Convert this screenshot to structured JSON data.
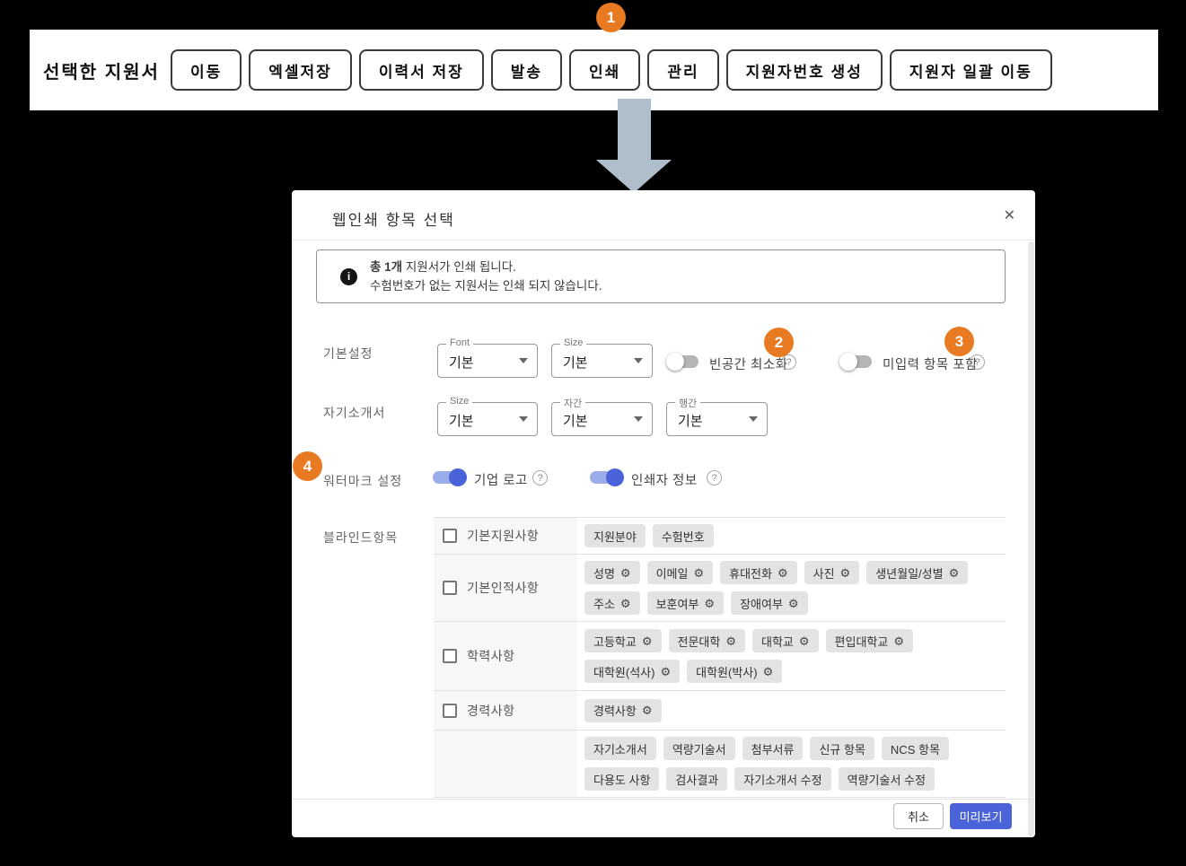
{
  "colors": {
    "accent_orange": "#E87A22",
    "primary_blue": "#4A63D9",
    "arrow_gray": "#B0BDCB",
    "chip_gray": "#E3E3E3"
  },
  "toolbar": {
    "label": "선택한 지원서",
    "buttons": [
      "이동",
      "엑셀저장",
      "이력서 저장",
      "발송",
      "인쇄",
      "관리",
      "지원자번호 생성",
      "지원자 일괄 이동"
    ]
  },
  "callouts": {
    "c1": "1",
    "c2": "2",
    "c3": "3",
    "c4": "4"
  },
  "modal": {
    "title": "웹인쇄 항목 선택",
    "close_icon": "✕",
    "notice": {
      "emphasis": "총 1개",
      "line1_rest": " 지원서가 인쇄 됩니다.",
      "line2": "수험번호가 없는 지원서는 인쇄 되지 않습니다."
    },
    "basic": {
      "label": "기본설정",
      "selects": [
        {
          "legend": "Font",
          "value": "기본"
        },
        {
          "legend": "Size",
          "value": "기본"
        }
      ],
      "toggle": {
        "label": "빈공간 최소화",
        "state": "off"
      }
    },
    "unfilled_toggle": {
      "label": "미입력 항목 포함",
      "state": "off"
    },
    "cover": {
      "label": "자기소개서",
      "selects": [
        {
          "legend": "Size",
          "value": "기본"
        },
        {
          "legend": "자간",
          "value": "기본"
        },
        {
          "legend": "행간",
          "value": "기본"
        }
      ]
    },
    "watermark": {
      "label": "워터마크 설정",
      "toggles": [
        {
          "label": "기업 로고",
          "state": "on"
        },
        {
          "label": "인쇄자 정보",
          "state": "on"
        }
      ]
    },
    "blind": {
      "label": "블라인드항목",
      "gear_icon": "⚙",
      "rows": [
        {
          "group": "기본지원사항",
          "checkbox": true,
          "lines": [
            [
              {
                "label": "지원분야",
                "gear": false
              },
              {
                "label": "수험번호",
                "gear": false
              }
            ]
          ]
        },
        {
          "group": "기본인적사항",
          "checkbox": true,
          "lines": [
            [
              {
                "label": "성명",
                "gear": true
              },
              {
                "label": "이메일",
                "gear": true
              },
              {
                "label": "휴대전화",
                "gear": true
              },
              {
                "label": "사진",
                "gear": true
              },
              {
                "label": "생년월일/성별",
                "gear": true
              }
            ],
            [
              {
                "label": "주소",
                "gear": true
              },
              {
                "label": "보훈여부",
                "gear": true
              },
              {
                "label": "장애여부",
                "gear": true
              }
            ]
          ]
        },
        {
          "group": "학력사항",
          "checkbox": true,
          "lines": [
            [
              {
                "label": "고등학교",
                "gear": true
              },
              {
                "label": "전문대학",
                "gear": true
              },
              {
                "label": "대학교",
                "gear": true
              },
              {
                "label": "편입대학교",
                "gear": true
              }
            ],
            [
              {
                "label": "대학원(석사)",
                "gear": true
              },
              {
                "label": "대학원(박사)",
                "gear": true
              }
            ]
          ]
        },
        {
          "group": "경력사항",
          "checkbox": true,
          "lines": [
            [
              {
                "label": "경력사항",
                "gear": true
              }
            ]
          ]
        },
        {
          "group": "",
          "checkbox": false,
          "lines": [
            [
              {
                "label": "자기소개서",
                "gear": false
              },
              {
                "label": "역량기술서",
                "gear": false
              },
              {
                "label": "첨부서류",
                "gear": false
              },
              {
                "label": "신규 항목",
                "gear": false
              },
              {
                "label": "NCS 항목",
                "gear": false
              }
            ],
            [
              {
                "label": "다용도 사항",
                "gear": false
              },
              {
                "label": "검사결과",
                "gear": false
              },
              {
                "label": "자기소개서 수정",
                "gear": false
              },
              {
                "label": "역량기술서 수정",
                "gear": false
              }
            ]
          ]
        }
      ]
    },
    "footer": {
      "cancel": "취소",
      "preview": "미리보기"
    }
  }
}
